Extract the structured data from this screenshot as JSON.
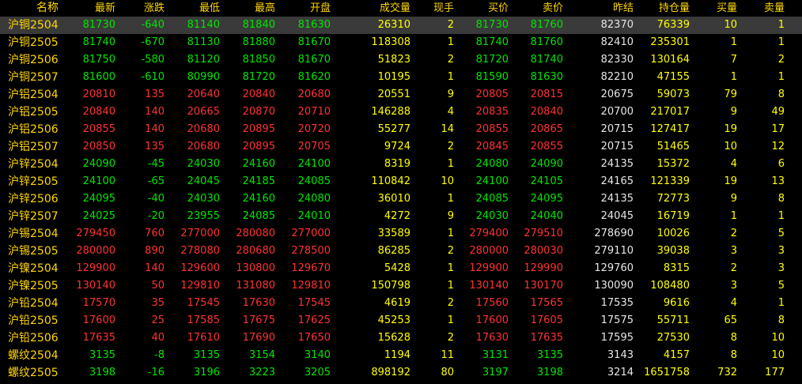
{
  "colors": {
    "up": "#ff3232",
    "down": "#00e600",
    "flat": "#e6e6e6",
    "yellow": "#ffff00",
    "header": "#ffd700",
    "selected_row_bg": "#3a3a3a"
  },
  "columns": [
    "名称",
    "最新",
    "涨跌",
    "最低",
    "最高",
    "开盘",
    "成交量",
    "现手",
    "买价",
    "卖价",
    "昨结",
    "持仓量",
    "买量",
    "卖量"
  ],
  "rows": [
    {
      "name": "沪铜2504",
      "last": "81730",
      "chg": "-640",
      "low": "81140",
      "high": "81840",
      "open": "81630",
      "vol": "26310",
      "cur": "2",
      "bid": "81730",
      "ask": "81760",
      "prev": "82370",
      "oi": "76339",
      "bidv": "10",
      "askv": "1",
      "dir": "down",
      "selected": true
    },
    {
      "name": "沪铜2505",
      "last": "81740",
      "chg": "-670",
      "low": "81130",
      "high": "81880",
      "open": "81670",
      "vol": "118308",
      "cur": "1",
      "bid": "81740",
      "ask": "81760",
      "prev": "82410",
      "oi": "235301",
      "bidv": "1",
      "askv": "1",
      "dir": "down"
    },
    {
      "name": "沪铜2506",
      "last": "81750",
      "chg": "-580",
      "low": "81120",
      "high": "81850",
      "open": "81670",
      "vol": "51823",
      "cur": "2",
      "bid": "81720",
      "ask": "81740",
      "prev": "82330",
      "oi": "130164",
      "bidv": "7",
      "askv": "2",
      "dir": "down"
    },
    {
      "name": "沪铜2507",
      "last": "81600",
      "chg": "-610",
      "low": "80990",
      "high": "81720",
      "open": "81620",
      "vol": "10195",
      "cur": "1",
      "bid": "81590",
      "ask": "81630",
      "prev": "82210",
      "oi": "47155",
      "bidv": "1",
      "askv": "1",
      "dir": "down"
    },
    {
      "name": "沪铝2504",
      "last": "20810",
      "chg": "135",
      "low": "20640",
      "high": "20840",
      "open": "20680",
      "vol": "20551",
      "cur": "9",
      "bid": "20805",
      "ask": "20815",
      "prev": "20675",
      "oi": "59073",
      "bidv": "79",
      "askv": "8",
      "dir": "up"
    },
    {
      "name": "沪铝2505",
      "last": "20840",
      "chg": "140",
      "low": "20665",
      "high": "20870",
      "open": "20710",
      "vol": "146288",
      "cur": "4",
      "bid": "20835",
      "ask": "20840",
      "prev": "20700",
      "oi": "217017",
      "bidv": "9",
      "askv": "49",
      "dir": "up"
    },
    {
      "name": "沪铝2506",
      "last": "20855",
      "chg": "140",
      "low": "20680",
      "high": "20895",
      "open": "20720",
      "vol": "55277",
      "cur": "14",
      "bid": "20855",
      "ask": "20865",
      "prev": "20715",
      "oi": "127417",
      "bidv": "19",
      "askv": "17",
      "dir": "up"
    },
    {
      "name": "沪铝2507",
      "last": "20850",
      "chg": "135",
      "low": "20680",
      "high": "20895",
      "open": "20705",
      "vol": "9724",
      "cur": "2",
      "bid": "20845",
      "ask": "20855",
      "prev": "20715",
      "oi": "51465",
      "bidv": "10",
      "askv": "12",
      "dir": "up"
    },
    {
      "name": "沪锌2504",
      "last": "24090",
      "chg": "-45",
      "low": "24030",
      "high": "24160",
      "open": "24100",
      "vol": "8319",
      "cur": "1",
      "bid": "24080",
      "ask": "24090",
      "prev": "24135",
      "oi": "15372",
      "bidv": "4",
      "askv": "6",
      "dir": "down"
    },
    {
      "name": "沪锌2505",
      "last": "24100",
      "chg": "-65",
      "low": "24045",
      "high": "24185",
      "open": "24085",
      "vol": "110842",
      "cur": "10",
      "bid": "24100",
      "ask": "24105",
      "prev": "24165",
      "oi": "121339",
      "bidv": "19",
      "askv": "13",
      "dir": "down"
    },
    {
      "name": "沪锌2506",
      "last": "24095",
      "chg": "-40",
      "low": "24030",
      "high": "24160",
      "open": "24080",
      "vol": "36010",
      "cur": "1",
      "bid": "24085",
      "ask": "24095",
      "prev": "24135",
      "oi": "72773",
      "bidv": "9",
      "askv": "8",
      "dir": "down"
    },
    {
      "name": "沪锌2507",
      "last": "24025",
      "chg": "-20",
      "low": "23955",
      "high": "24085",
      "open": "24010",
      "vol": "4272",
      "cur": "9",
      "bid": "24030",
      "ask": "24040",
      "prev": "24045",
      "oi": "16719",
      "bidv": "1",
      "askv": "1",
      "dir": "down"
    },
    {
      "name": "沪锡2504",
      "last": "279450",
      "chg": "760",
      "low": "277000",
      "high": "280080",
      "open": "277000",
      "vol": "33589",
      "cur": "1",
      "bid": "279400",
      "ask": "279510",
      "prev": "278690",
      "oi": "10026",
      "bidv": "2",
      "askv": "5",
      "dir": "up"
    },
    {
      "name": "沪锡2505",
      "last": "280000",
      "chg": "890",
      "low": "278080",
      "high": "280680",
      "open": "278500",
      "vol": "86285",
      "cur": "2",
      "bid": "280000",
      "ask": "280030",
      "prev": "279110",
      "oi": "39038",
      "bidv": "3",
      "askv": "3",
      "dir": "up"
    },
    {
      "name": "沪镍2504",
      "last": "129900",
      "chg": "140",
      "low": "129600",
      "high": "130800",
      "open": "129670",
      "vol": "5428",
      "cur": "1",
      "bid": "129900",
      "ask": "129990",
      "prev": "129760",
      "oi": "8315",
      "bidv": "2",
      "askv": "3",
      "dir": "up"
    },
    {
      "name": "沪镍2505",
      "last": "130140",
      "chg": "50",
      "low": "129810",
      "high": "131080",
      "open": "129810",
      "vol": "150798",
      "cur": "1",
      "bid": "130140",
      "ask": "130170",
      "prev": "130090",
      "oi": "108480",
      "bidv": "3",
      "askv": "5",
      "dir": "up"
    },
    {
      "name": "沪铅2504",
      "last": "17570",
      "chg": "35",
      "low": "17545",
      "high": "17630",
      "open": "17545",
      "vol": "4619",
      "cur": "2",
      "bid": "17560",
      "ask": "17565",
      "prev": "17535",
      "oi": "9616",
      "bidv": "4",
      "askv": "1",
      "dir": "up"
    },
    {
      "name": "沪铅2505",
      "last": "17600",
      "chg": "25",
      "low": "17585",
      "high": "17675",
      "open": "17625",
      "vol": "45253",
      "cur": "1",
      "bid": "17600",
      "ask": "17605",
      "prev": "17575",
      "oi": "55711",
      "bidv": "65",
      "askv": "8",
      "dir": "up"
    },
    {
      "name": "沪铅2506",
      "last": "17635",
      "chg": "40",
      "low": "17610",
      "high": "17690",
      "open": "17650",
      "vol": "15628",
      "cur": "2",
      "bid": "17630",
      "ask": "17635",
      "prev": "17595",
      "oi": "27530",
      "bidv": "8",
      "askv": "10",
      "dir": "up"
    },
    {
      "name": "螺纹2504",
      "last": "3135",
      "chg": "-8",
      "low": "3135",
      "high": "3154",
      "open": "3140",
      "vol": "1194",
      "cur": "11",
      "bid": "3131",
      "ask": "3135",
      "prev": "3143",
      "oi": "4157",
      "bidv": "8",
      "askv": "10",
      "dir": "down"
    },
    {
      "name": "螺纹2505",
      "last": "3198",
      "chg": "-16",
      "low": "3196",
      "high": "3223",
      "open": "3205",
      "vol": "898192",
      "cur": "80",
      "bid": "3197",
      "ask": "3198",
      "prev": "3214",
      "oi": "1651758",
      "bidv": "732",
      "askv": "177",
      "dir": "down"
    }
  ]
}
